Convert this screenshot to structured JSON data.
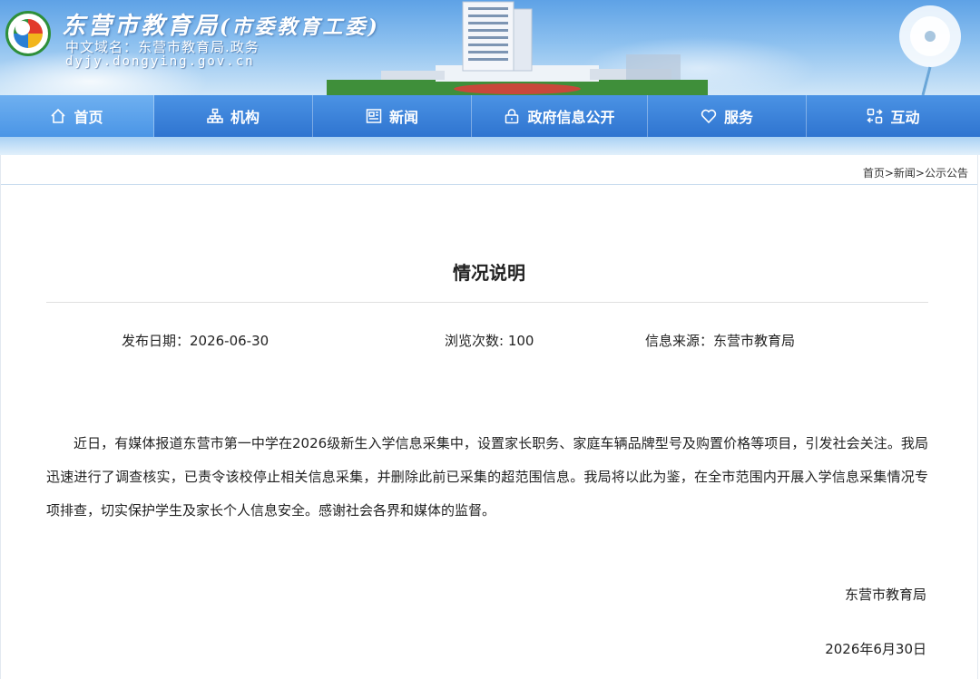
{
  "header": {
    "title_main": "东营市教育局",
    "title_sub": "(市委教育工委)",
    "domain_cn": "中文域名：东营市教育局.政务",
    "domain_url": "dyjy.dongying.gov.cn"
  },
  "nav": {
    "items": [
      {
        "label": "首页",
        "icon": "home-icon",
        "active": true
      },
      {
        "label": "机构",
        "icon": "org-chart-icon"
      },
      {
        "label": "新闻",
        "icon": "newspaper-icon"
      },
      {
        "label": "政府信息公开",
        "icon": "lock-icon"
      },
      {
        "label": "服务",
        "icon": "heart-icon"
      },
      {
        "label": "互动",
        "icon": "interaction-icon"
      }
    ]
  },
  "breadcrumb": {
    "home": "首页",
    "sep": ">",
    "news": "新闻",
    "current": "公示公告"
  },
  "article": {
    "title": "情况说明",
    "publish_date": "发布日期：2026-06-30",
    "views": "浏览次数: 100",
    "source": "信息来源：东营市教育局",
    "body": "近日，有媒体报道东营市第一中学在2026级新生入学信息采集中，设置家长职务、家庭车辆品牌型号及购置价格等项目，引发社会关注。我局迅速进行了调查核实，已责令该校停止相关信息采集，并删除此前已采集的超范围信息。我局将以此为鉴，在全市范围内开展入学信息采集情况专项排查，切实保护学生及家长个人信息安全。感谢社会各界和媒体的监督。",
    "signature": "东营市教育局",
    "sign_date": "2026年6月30日"
  },
  "colors": {
    "nav_bg": "#2f74d0",
    "nav_active": "#5aa2ec",
    "banner_sky": "#8cc0ef"
  }
}
